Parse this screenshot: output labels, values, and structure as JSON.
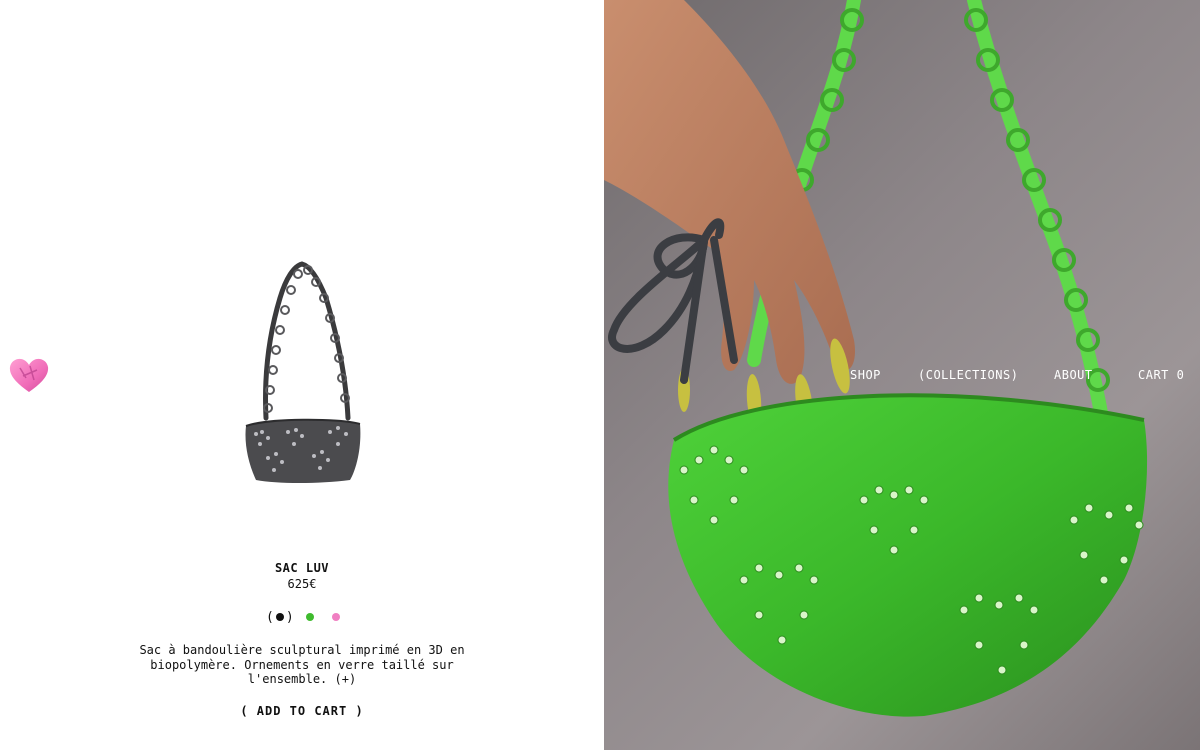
{
  "nav": {
    "shop": "SHOP",
    "collections": "(COLLECTIONS)",
    "about": "ABOUT",
    "cart": "CART 0"
  },
  "product": {
    "name": "SAC LUV",
    "price": "625€",
    "swatch_open": "(",
    "swatch_close": ")",
    "swatches": [
      {
        "name": "black",
        "color": "#111111",
        "selected": true
      },
      {
        "name": "green",
        "color": "#3fbb2e",
        "selected": false
      },
      {
        "name": "pink",
        "color": "#f07fc2",
        "selected": false
      }
    ],
    "description": "Sac à bandoulière sculptural imprimé en 3D en biopolymère. Ornements en verre taillé sur l'ensemble.",
    "more_label": "(+)",
    "add_to_cart": "( ADD TO CART )"
  },
  "icons": {
    "logo": "heart-logo-icon"
  },
  "colors": {
    "accent_green": "#3fbb2e",
    "pink": "#f07fc2",
    "hero_bg": "#8d8689"
  }
}
